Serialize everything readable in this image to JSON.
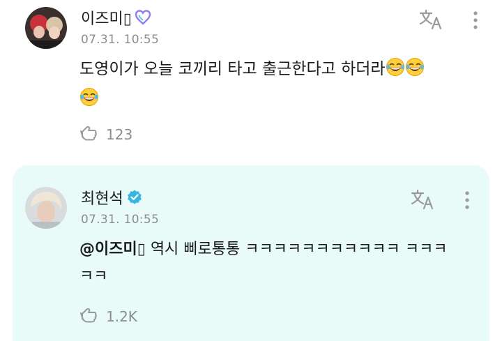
{
  "post": {
    "author": "이즈미▯",
    "timestamp": "07.31. 10:55",
    "text": "도영이가 오늘 코끼리 타고 출근한다고 하더라",
    "trailing_emoji_count": 3,
    "likes": "123",
    "badge_icon": "purple-heart-outline-icon"
  },
  "reply": {
    "author": "최현석",
    "timestamp": "07.31. 10:55",
    "mention": "@이즈미▯",
    "text": " 역시 삐로통통 ㅋㅋㅋㅋㅋㅋㅋㅋㅋㅋㅋ ㅋㅋㅋㅋㅋ",
    "likes": "1.2K",
    "badge_icon": "verified-check-icon"
  },
  "colors": {
    "reply_background": "#e9fbf9",
    "timestamp": "#8c8c8c",
    "verified": "#37b6e0",
    "badge_heart": "#8e7cf0"
  },
  "icons": [
    "translate-icon",
    "more-vertical-icon",
    "like-hand-icon",
    "laughing-tears-emoji"
  ]
}
